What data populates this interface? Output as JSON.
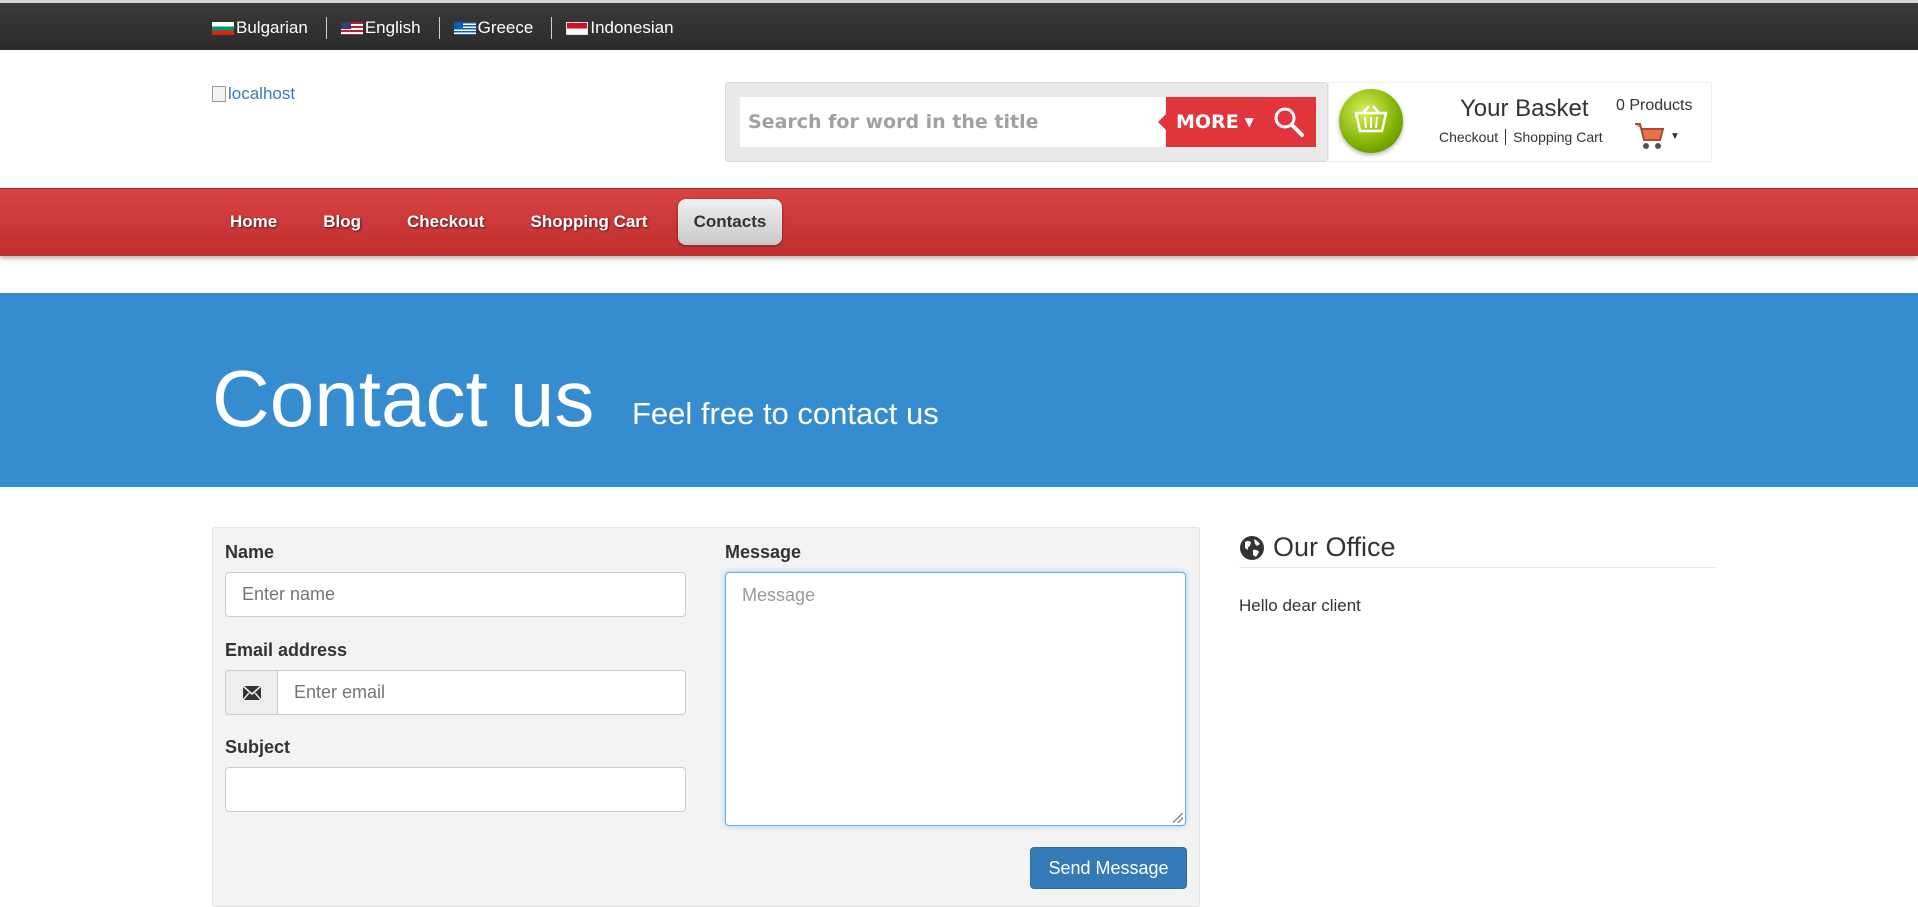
{
  "languages": [
    {
      "label": "Bulgarian",
      "flag": "bulgaria-flag"
    },
    {
      "label": "English",
      "flag": "usa-flag"
    },
    {
      "label": "Greece",
      "flag": "greece-flag"
    },
    {
      "label": "Indonesian",
      "flag": "indonesia-flag"
    }
  ],
  "header": {
    "logo_alt": "localhost",
    "search_placeholder": "Search for word in the title",
    "more_label": "MORE",
    "basket_title": "Your Basket",
    "products_count": "0 Products",
    "checkout_link": "Checkout",
    "shopping_cart_link": "Shopping Cart"
  },
  "nav": {
    "items": [
      "Home",
      "Blog",
      "Checkout",
      "Shopping Cart",
      "Contacts"
    ],
    "active": "Contacts"
  },
  "banner": {
    "title": "Contact us",
    "subtitle": "Feel free to contact us"
  },
  "form": {
    "name_label": "Name",
    "name_placeholder": "Enter name",
    "email_label": "Email address",
    "email_placeholder": "Enter email",
    "subject_label": "Subject",
    "subject_value": "",
    "message_label": "Message",
    "message_placeholder": "Message",
    "send_label": "Send Message"
  },
  "office": {
    "title": "Our Office",
    "text": "Hello dear client"
  },
  "colors": {
    "topbar": "#2f2f2f",
    "nav_red": "#c93737",
    "accent_red": "#e0353b",
    "banner_blue": "#358dd0",
    "button_blue": "#337ab7"
  }
}
